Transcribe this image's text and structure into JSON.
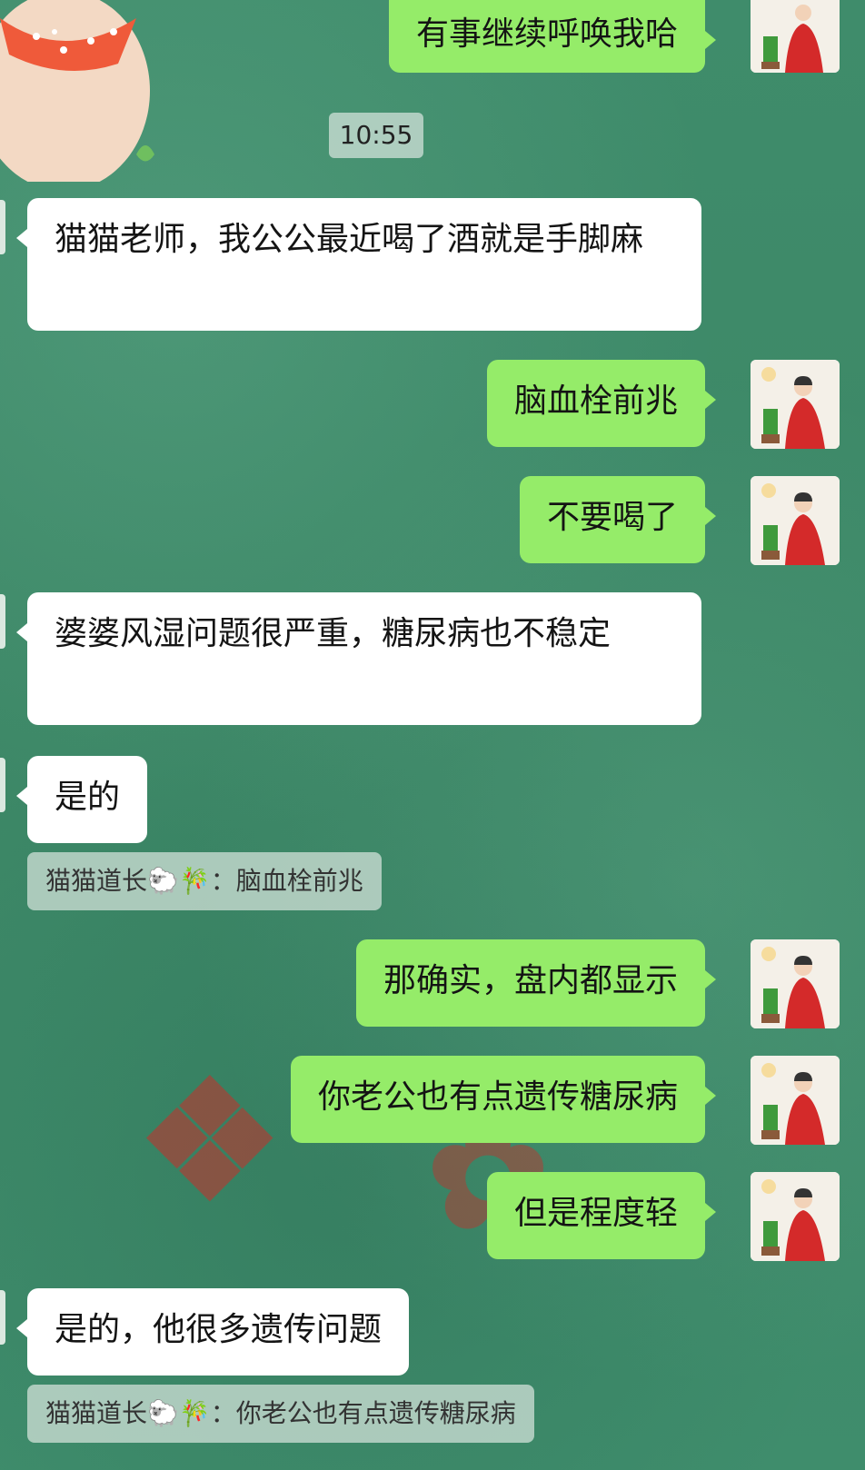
{
  "chat": {
    "time_divider": "10:55",
    "messages": [
      {
        "side": "me",
        "text": "有事继续呼唤我哈"
      },
      {
        "side": "them",
        "text": "猫猫老师，我公公最近喝了酒就是手脚麻"
      },
      {
        "side": "me",
        "text": "脑血栓前兆"
      },
      {
        "side": "me",
        "text": "不要喝了"
      },
      {
        "side": "them",
        "text": "婆婆风湿问题很严重，糖尿病也不稳定"
      },
      {
        "side": "them",
        "text": "是的"
      },
      {
        "side": "me",
        "text": "那确实，盘内都显示"
      },
      {
        "side": "me",
        "text": "你老公也有点遗传糖尿病"
      },
      {
        "side": "me",
        "text": "但是程度轻"
      },
      {
        "side": "them",
        "text": "是的，他很多遗传问题"
      }
    ],
    "quotes": [
      {
        "sender": "猫猫道长🐑🎋",
        "sep": "：",
        "text": "脑血栓前兆"
      },
      {
        "sender": "猫猫道长🐑🎋",
        "sep": "：",
        "text": "你老公也有点遗传糖尿病"
      }
    ]
  },
  "colors": {
    "background": "#3e8a68",
    "my_bubble": "#95ec69",
    "their_bubble": "#ffffff"
  },
  "icons": {
    "my_avatar": "avatar-woman-red-hanfu",
    "sticker": "cartoon-pig-sticker"
  }
}
